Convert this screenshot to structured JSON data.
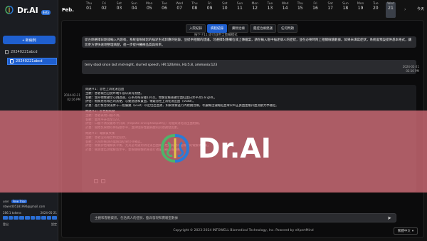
{
  "app": {
    "name": "Dr.AI",
    "badge": "Beta"
  },
  "sidebar": {
    "new_button": "+ 新病例",
    "conversations": [
      {
        "label": "20240221abcd"
      },
      {
        "label": "20240221abcd"
      }
    ],
    "user": {
      "label": "user",
      "plan": "Free Trial",
      "email": "ntwerd05181990@gmail.com",
      "usage": "286.1 tokens",
      "usage_date": "2024-05-21",
      "logout": "登出",
      "settings": "設定"
    }
  },
  "datebar": {
    "month": "Feb.",
    "days": [
      {
        "dow": "Thu",
        "num": "01"
      },
      {
        "dow": "Fri",
        "num": "02"
      },
      {
        "dow": "Sat",
        "num": "03"
      },
      {
        "dow": "Sun",
        "num": "04"
      },
      {
        "dow": "Mon",
        "num": "05"
      },
      {
        "dow": "Tue",
        "num": "06"
      },
      {
        "dow": "Wed",
        "num": "07"
      },
      {
        "dow": "Thu",
        "num": "08"
      },
      {
        "dow": "Fri",
        "num": "09"
      },
      {
        "dow": "Sat",
        "num": "10"
      },
      {
        "dow": "Sun",
        "num": "11"
      },
      {
        "dow": "Mon",
        "num": "12"
      },
      {
        "dow": "Tue",
        "num": "13"
      },
      {
        "dow": "Wed",
        "num": "14"
      },
      {
        "dow": "Thu",
        "num": "15"
      },
      {
        "dow": "Fri",
        "num": "16"
      },
      {
        "dow": "Sat",
        "num": "17"
      },
      {
        "dow": "Sun",
        "num": "18"
      },
      {
        "dow": "Mon",
        "num": "19"
      },
      {
        "dow": "Tue",
        "num": "20"
      },
      {
        "dow": "Wed",
        "num": "21"
      }
    ],
    "today": "今天"
  },
  "tabs": [
    {
      "label": "入院紀錄",
      "active": false
    },
    {
      "label": "病程紀錄",
      "active": true
    },
    {
      "label": "藥物治療",
      "active": false
    },
    {
      "label": "鑑症治療建議",
      "active": false
    },
    {
      "label": "任何問題",
      "active": false
    }
  ],
  "shortcut_hint": "按下 F11 即可啟用全螢幕模式",
  "messages": {
    "system": "從左側選擇日期或輸入內容後，系統會根據您的描述生成對應的紀錄，並提供相關的建議。可選擇對應欄位或上傳檔案，請在輸入框中描述病人的症狀，並在必要時附上相關檢驗數據。如果未填寫症狀，系統會預設提供基本格式，讓您更方便快速地整理病歷，進一步提升醫療品質與效率。",
    "user_text": "terry stool since last mid-night, slurred speech, HR:120/min, Hb:5.8, ammonia:123",
    "user_date": "2024-02-21",
    "user_time": "02:16 PM",
    "ai_date": "2024-02-21",
    "ai_time": "02:16 PM",
    "ai_lines": [
      "問題＃1：急性上消化道出血",
      "主觀：患者報告自從昨晚午夜以來有黑便。",
      "客觀：生命徵象顯示心跳過速，心率為每分鐘120次。實驗室檢查顯示血紅蛋白水平為5.8 g/dL。",
      "評估：根據患者報告的黑便，心動過速和貧血，懷疑急性上消化道出血（UGIB）。",
      "計畫：進行緊急食道胃十二指腸鏡（EGD）以定位出血源，如果需要進行內視鏡治療。考慮輸注濃縮紅血球以糾正貧血並維持血流動力學穩定。",
      "問題＃2：肝性腦病變",
      "主觀：患者表現口齒不清。",
      "客觀：氨水平升高至123。",
      "評估：口齒不清及氨水平升高（hepatic encephalopathy）可能與消化道出血相關。",
      "計畫：開始乳果糖以降低氨水平，並評估肝性腦病變的其他誘發因素。",
      "問題＃3：電解質失衡",
      "主觀：患者沒有報告特定症狀。",
      "客觀：入院時檢測的電解質結果仍待確認。",
      "評估：需要評估電解質平衡，尤其是考慮到消化道出血和肝性腦病變可能導致的電解質紊亂。",
      "計畫：檢測並監測電解質水平，並根據檢驗結果進行適當的補充或調整。"
    ]
  },
  "input": {
    "placeholder": "主觀和客觀資訊，包括病人的症狀、臨床發現和實驗室數據"
  },
  "footer": {
    "copyright": "Copyright © 2023-2024 INTOWELL Biomedical Technology, Inc. Powered by eXpertMind",
    "language": "繁體中文"
  },
  "watermark": {
    "text": "Dr.AI"
  },
  "colors": {
    "accent": "#1f5fcf",
    "overlay": "#d66e7a"
  }
}
